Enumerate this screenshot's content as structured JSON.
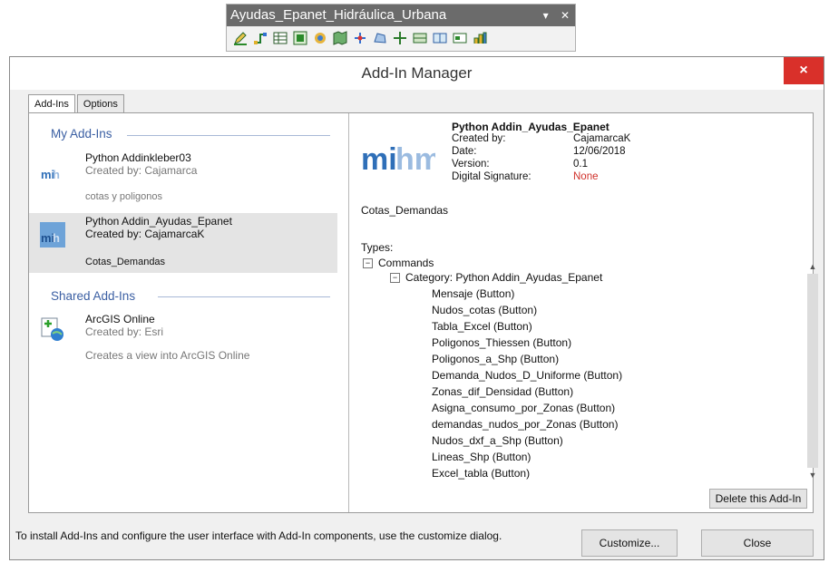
{
  "toolbar": {
    "title": "Ayudas_Epanet_Hidráulica_Urbana",
    "controls": [
      "▾",
      "✕"
    ],
    "icons": [
      "edit-icon",
      "network-icon",
      "table-icon",
      "grid-icon",
      "tool-icon",
      "map-icon",
      "node-icon",
      "polygon-icon",
      "move-icon",
      "layer-icon",
      "layer2-icon",
      "export-icon",
      "chart-icon"
    ]
  },
  "dialog": {
    "title": "Add-In Manager",
    "close": "×",
    "tabs": [
      "Add-Ins",
      "Options"
    ],
    "my_addins_label": "My Add-Ins",
    "shared_addins_label": "Shared Add-Ins",
    "addins": [
      {
        "name": "Python Addinkleber03",
        "by": "Created by: Cajamarca",
        "desc": "cotas y poligonos"
      },
      {
        "name": "Python Addin_Ayudas_Epanet",
        "by": "Created by: CajamarcaK",
        "desc": "Cotas_Demandas"
      }
    ],
    "shared": [
      {
        "name": "ArcGIS Online",
        "by": "Created by: Esri",
        "desc": "Creates a view into ArcGIS Online"
      }
    ],
    "logo_text": "mihma",
    "details": {
      "name": "Python Addin_Ayudas_Epanet",
      "labels": [
        "Created by:",
        "Date:",
        "Version:",
        "Digital Signature:"
      ],
      "values": [
        "CajamarcaK",
        "12/06/2018",
        "0.1",
        "None"
      ],
      "description": "Cotas_Demandas",
      "types_label": "Types:",
      "tree_root": "Commands",
      "category": "Category: Python Addin_Ayudas_Epanet",
      "commands": [
        "Mensaje (Button)",
        "Nudos_cotas (Button)",
        "Tabla_Excel (Button)",
        "Poligonos_Thiessen (Button)",
        "Poligonos_a_Shp (Button)",
        "Demanda_Nudos_D_Uniforme (Button)",
        "Zonas_dif_Densidad (Button)",
        "Asigna_consumo_por_Zonas (Button)",
        "demandas_nudos_por_Zonas (Button)",
        "Nudos_dxf_a_Shp (Button)",
        "Lineas_Shp (Button)",
        "Excel_tabla (Button)"
      ],
      "delete_button": "Delete this Add-In"
    },
    "footer": {
      "text": "To install Add-Ins and configure the user interface with Add-In components, use the customize dialog.",
      "customize_button": "Customize...",
      "close_button": "Close"
    },
    "colors": {
      "close_red": "#d9302a",
      "section_blue": "#3b5fa3",
      "signature_red": "#d0302a"
    }
  }
}
